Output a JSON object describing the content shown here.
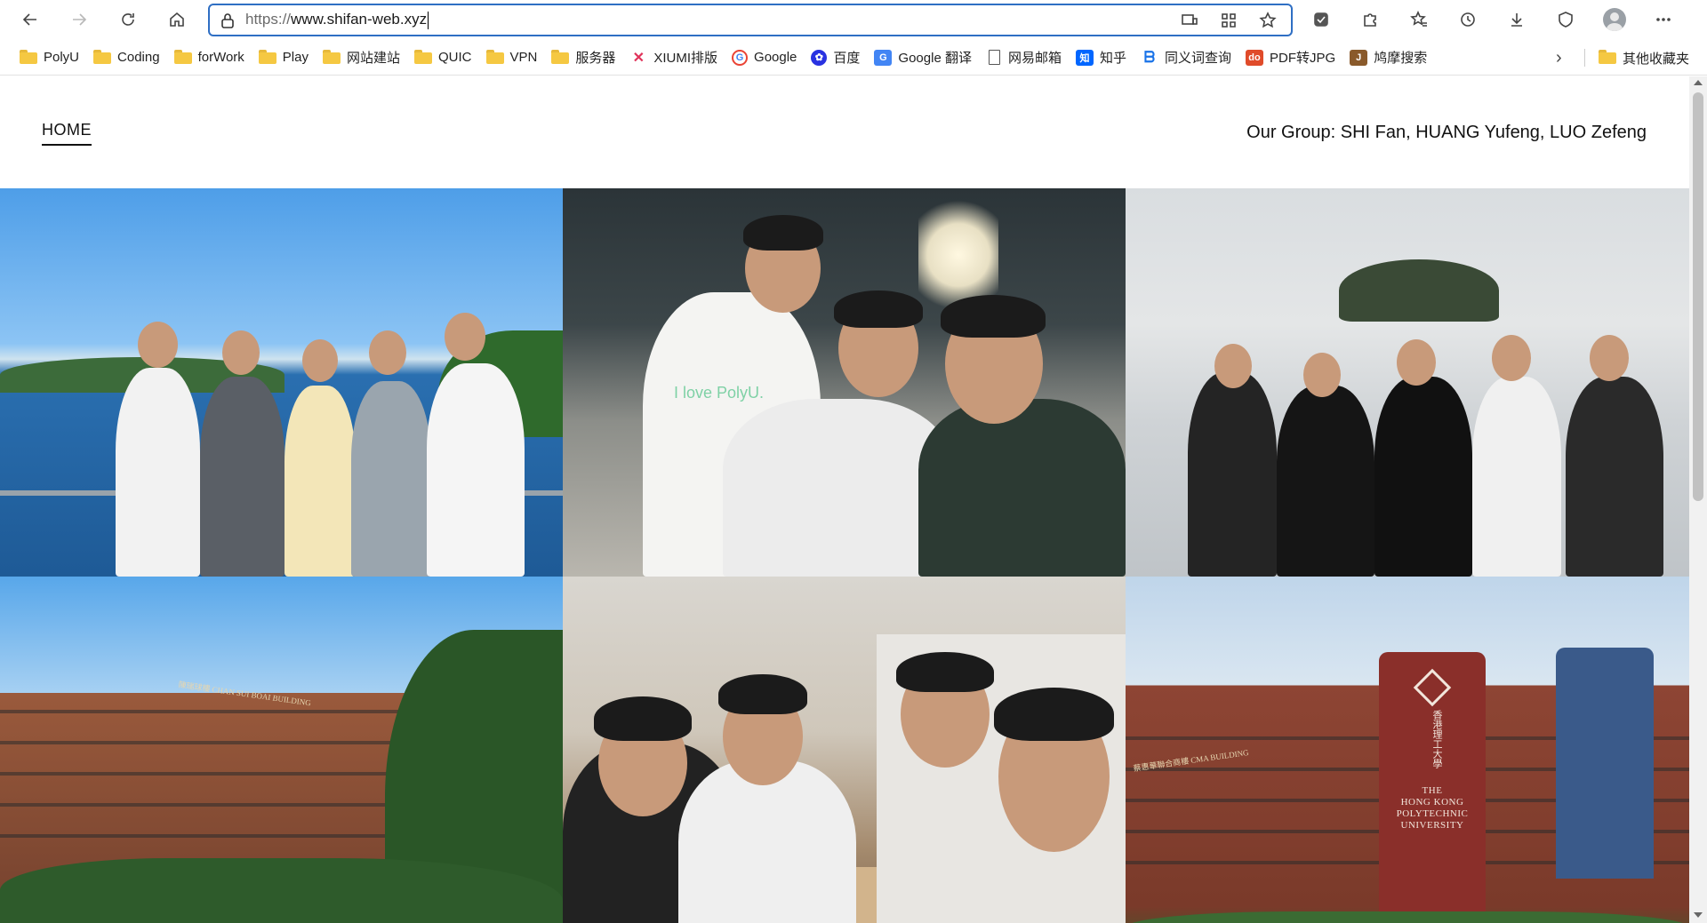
{
  "browser": {
    "url_scheme": "https://",
    "url_host": "www.shifan-web.xyz",
    "bookmarks": [
      {
        "label": "PolyU",
        "icon": "folder-icon"
      },
      {
        "label": "Coding",
        "icon": "folder-icon"
      },
      {
        "label": "forWork",
        "icon": "folder-icon"
      },
      {
        "label": "Play",
        "icon": "folder-icon"
      },
      {
        "label": "网站建站",
        "icon": "folder-icon"
      },
      {
        "label": "QUIC",
        "icon": "folder-icon"
      },
      {
        "label": "VPN",
        "icon": "folder-icon"
      },
      {
        "label": "服务器",
        "icon": "folder-icon"
      },
      {
        "label": "XIUMI排版",
        "icon": "xiumi-icon"
      },
      {
        "label": "Google",
        "icon": "google-icon"
      },
      {
        "label": "百度",
        "icon": "baidu-icon"
      },
      {
        "label": "Google 翻译",
        "icon": "google-translate-icon"
      },
      {
        "label": "网易邮箱",
        "icon": "page-icon"
      },
      {
        "label": "知乎",
        "icon": "zhihu-icon"
      },
      {
        "label": "同义词查询",
        "icon": "bing-icon"
      },
      {
        "label": "PDF转JPG",
        "icon": "pdf-icon"
      },
      {
        "label": "鸠摩搜索",
        "icon": "jiumo-icon"
      }
    ],
    "other_bookmarks": "其他收藏夹"
  },
  "site": {
    "nav_home": "HOME",
    "group": "Our Group: SHI Fan, HUANG Yufeng, LUO Zefeng",
    "photo_overlay": "I love PolyU.",
    "tower_chinese": "香港理工大學",
    "tower_english_1": "THE",
    "tower_english_2": "HONG KONG",
    "tower_english_3": "POLYTECHNIC",
    "tower_english_4": "UNIVERSITY",
    "building_sign_4": "陳瑞球樓 CHAN SUI BOAI BUILDING",
    "building_sign_6": "蔡惠華聯合商樓 CMA BUILDING"
  },
  "colors": {
    "address_border": "#2f6fc4",
    "folder": "#f5c842"
  }
}
